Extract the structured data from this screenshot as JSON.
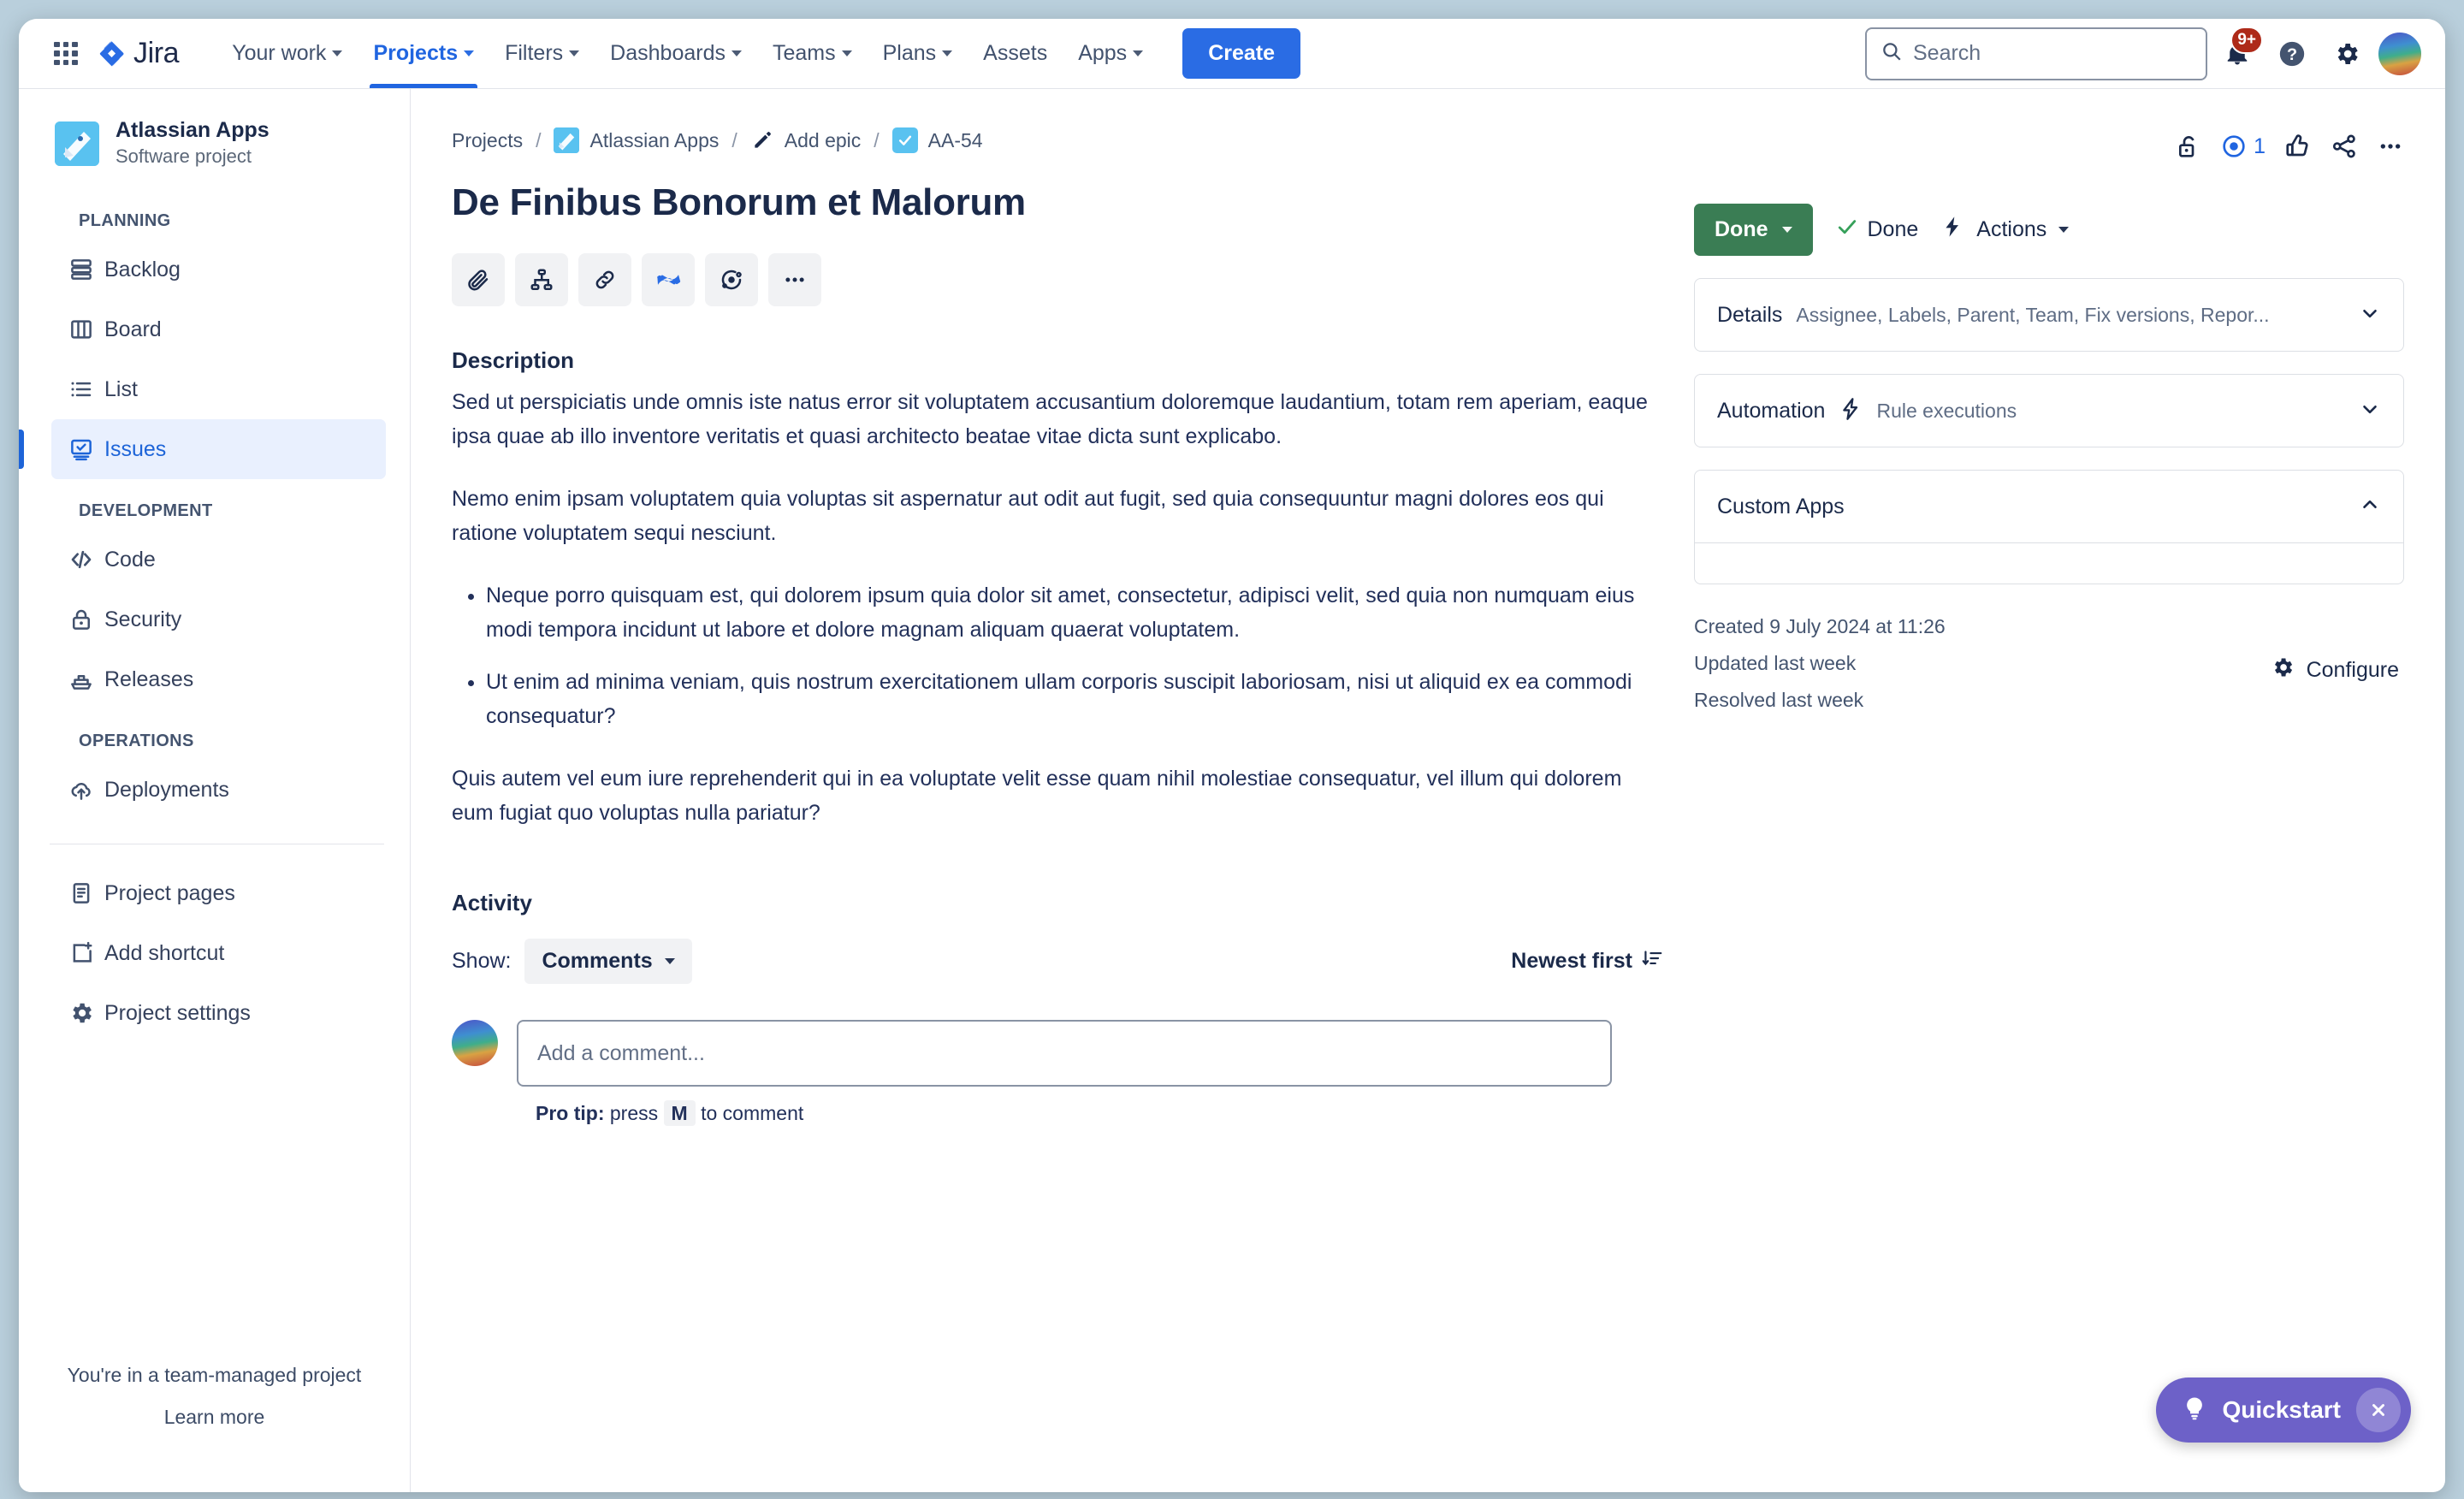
{
  "topnav": {
    "logo_text": "Jira",
    "items": [
      {
        "label": "Your work",
        "has_caret": true,
        "active": false
      },
      {
        "label": "Projects",
        "has_caret": true,
        "active": true
      },
      {
        "label": "Filters",
        "has_caret": true,
        "active": false
      },
      {
        "label": "Dashboards",
        "has_caret": true,
        "active": false
      },
      {
        "label": "Teams",
        "has_caret": true,
        "active": false
      },
      {
        "label": "Plans",
        "has_caret": true,
        "active": false
      },
      {
        "label": "Assets",
        "has_caret": false,
        "active": false
      },
      {
        "label": "Apps",
        "has_caret": true,
        "active": false
      }
    ],
    "create_label": "Create",
    "search_placeholder": "Search",
    "search_value": "",
    "notification_badge": "9+",
    "accent_color": "#2a6ce4"
  },
  "sidebar": {
    "project_name": "Atlassian Apps",
    "project_type": "Software project",
    "groups": [
      {
        "label": "PLANNING",
        "items": [
          {
            "label": "Backlog",
            "icon": "backlog-icon",
            "selected": false
          },
          {
            "label": "Board",
            "icon": "board-icon",
            "selected": false
          },
          {
            "label": "List",
            "icon": "list-icon",
            "selected": false
          },
          {
            "label": "Issues",
            "icon": "issues-icon",
            "selected": true
          }
        ]
      },
      {
        "label": "DEVELOPMENT",
        "items": [
          {
            "label": "Code",
            "icon": "code-icon",
            "selected": false
          },
          {
            "label": "Security",
            "icon": "lock-icon",
            "selected": false
          },
          {
            "label": "Releases",
            "icon": "ship-icon",
            "selected": false
          }
        ]
      },
      {
        "label": "OPERATIONS",
        "items": [
          {
            "label": "Deployments",
            "icon": "cloud-upload-icon",
            "selected": false
          }
        ]
      }
    ],
    "extra_items": [
      {
        "label": "Project pages",
        "icon": "page-icon"
      },
      {
        "label": "Add shortcut",
        "icon": "add-shortcut-icon"
      },
      {
        "label": "Project settings",
        "icon": "gear-icon"
      }
    ],
    "footer_note": "You're in a team-managed project",
    "footer_link": "Learn more"
  },
  "breadcrumb": {
    "projects": "Projects",
    "project": "Atlassian Apps",
    "epic": "Add epic",
    "issue_key": "AA-54"
  },
  "issue": {
    "title": "De Finibus Bonorum et Malorum",
    "action_icons": [
      "attach-icon",
      "child-issue-icon",
      "link-icon",
      "confluence-icon",
      "loom-icon",
      "more-actions-icon"
    ]
  },
  "description": {
    "heading": "Description",
    "paragraph_1": "Sed ut perspiciatis unde omnis iste natus error sit voluptatem accusantium doloremque laudantium, totam rem aperiam, eaque ipsa quae ab illo inventore veritatis et quasi architecto beatae vitae dicta sunt explicabo.",
    "paragraph_2": "Nemo enim ipsam voluptatem quia voluptas sit aspernatur aut odit aut fugit, sed quia consequuntur magni dolores eos qui ratione voluptatem sequi nesciunt.",
    "bullets": [
      "Neque porro quisquam est, qui dolorem ipsum quia dolor sit amet, consectetur, adipisci velit, sed quia non numquam eius modi tempora incidunt ut labore et dolore magnam aliquam quaerat voluptatem.",
      "Ut enim ad minima veniam, quis nostrum exercitationem ullam corporis suscipit laboriosam, nisi ut aliquid ex ea commodi consequatur?"
    ],
    "paragraph_3": "Quis autem vel eum iure reprehenderit qui in ea voluptate velit esse quam nihil molestiae consequatur, vel illum qui dolorem eum fugiat quo voluptas nulla pariatur?"
  },
  "activity": {
    "heading": "Activity",
    "show_label": "Show:",
    "filter_value": "Comments",
    "sort_label": "Newest first",
    "comment_placeholder": "Add a comment...",
    "comment_value": "",
    "protip_prefix": "Pro tip:",
    "protip_press": "press",
    "protip_key": "M",
    "protip_suffix": "to comment"
  },
  "right_panel": {
    "watch_count": "1",
    "header_icons": [
      "unlock-icon",
      "watch-icon",
      "like-icon",
      "share-icon",
      "more-icon"
    ],
    "status_button": "Done",
    "status_color": "#3a7d54",
    "resolution_label": "Done",
    "actions_label": "Actions",
    "details": {
      "title": "Details",
      "subtitle": "Assignee, Labels, Parent, Team, Fix versions, Repor..."
    },
    "automation": {
      "title": "Automation",
      "subtitle": "Rule executions"
    },
    "custom_apps": {
      "title": "Custom Apps"
    },
    "created": "Created 9 July 2024 at 11:26",
    "updated": "Updated last week",
    "resolved": "Resolved last week",
    "configure_label": "Configure"
  },
  "quickstart": {
    "label": "Quickstart",
    "color": "#6d61c8"
  }
}
